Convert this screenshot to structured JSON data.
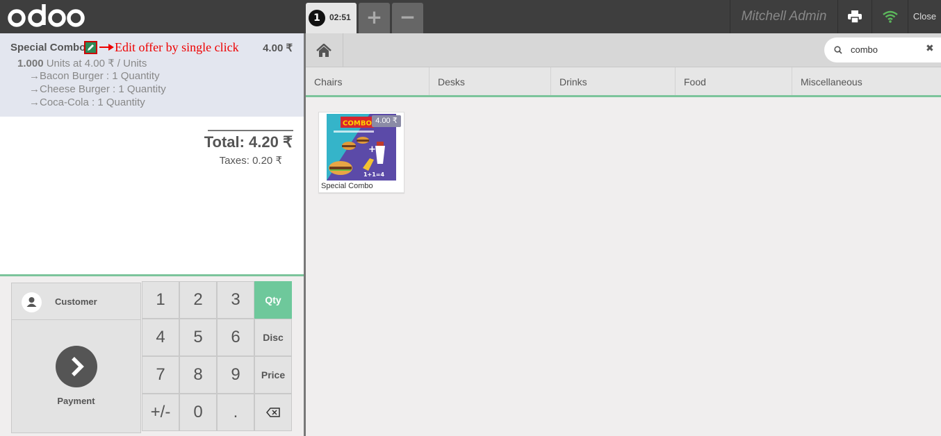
{
  "header": {
    "logo_text": "odoo",
    "order_tab": {
      "number": "1",
      "time": "02:51"
    },
    "add_order_label": "+",
    "remove_order_label": "−",
    "user_name": "Mitchell Admin",
    "close_label": "Close",
    "colors": {
      "bar": "#3e3e3e",
      "wifi": "#5cb85c"
    }
  },
  "orderline": {
    "name": "Special Combo",
    "edit_hint": "Edit offer by single click",
    "price": "4.00 ₹",
    "quantity": "1.000",
    "unit_info": "Units at 4.00 ₹ / Units",
    "combo_items": [
      "→Bacon Burger : 1 Quantity",
      "→Cheese Burger : 1 Quantity",
      "→Coca-Cola : 1 Quantity"
    ]
  },
  "summary": {
    "total": "Total: 4.20 ₹",
    "taxes": "Taxes: 0.20 ₹"
  },
  "actionpad": {
    "customer_label": "Customer",
    "payment_label": "Payment"
  },
  "numpad": {
    "keys": [
      "1",
      "2",
      "3",
      "4",
      "5",
      "6",
      "7",
      "8",
      "9",
      "+/-",
      "0",
      "."
    ],
    "modes": [
      "Qty",
      "Disc",
      "Price"
    ],
    "active_mode": "Qty",
    "accent": "#6ec89b"
  },
  "search": {
    "value": "combo"
  },
  "categories": [
    "Chairs",
    "Desks",
    "Drinks",
    "Food",
    "Miscellaneous"
  ],
  "products": [
    {
      "name": "Special Combo",
      "price": "4.00 ₹",
      "image_text": "COMBO",
      "image_caption": "1+1=4"
    }
  ]
}
